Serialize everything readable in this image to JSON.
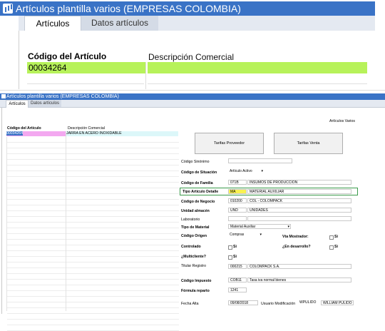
{
  "zoom": {
    "window_title": "Artículos plantilla varios (EMPRESAS COLOMBIA)",
    "tabs": [
      {
        "label": "Artículos",
        "active": true
      },
      {
        "label": "Datos artículos",
        "active": false
      }
    ],
    "code_label": "Código del Artículo",
    "desc_label": "Descripción Comercial",
    "code_value": "00034264",
    "desc_value": "",
    "highlight_color": "#b7f25a"
  },
  "main": {
    "window_title": "Artículos plantilla varios (EMPRESAS COLOMBIA)",
    "tabs": [
      {
        "label": "Artículos",
        "active": true
      },
      {
        "label": "Datos artículos",
        "active": false
      }
    ],
    "section_title": "Artículos Varios",
    "grid": {
      "col_code": "Código del Artículo",
      "col_desc": "Descripción Comercial",
      "first_code": "00034264",
      "first_desc": "JARRA EN ACERO INOXIDABLE"
    },
    "buttons": {
      "tarifas_proveedor": "Tarifas Proveedor",
      "tarifas_venta": "Tarifas Venta"
    },
    "form": {
      "codigo_sinonimo": {
        "label": "Código Sinónimo",
        "value": ""
      },
      "codigo_situacion": {
        "label": "Código de Situación",
        "value": "Artículo Activo"
      },
      "codigo_familia": {
        "label": "Código de Familia",
        "code": "071B",
        "desc": "INSUMOS DE PRODUCCION"
      },
      "tipo_articulo_detalle": {
        "label": "Tipo Artículo Detalle",
        "code": "MA",
        "desc": "MATERIAL AUXILIAR"
      },
      "codigo_negocio": {
        "label": "Código de Negocio",
        "code": "010200",
        "desc": "COL - COLOMPACK"
      },
      "unidad_almacen": {
        "label": "Unidad almacén",
        "code": "UND",
        "desc": "UNIDADES"
      },
      "laboratorio": {
        "label": "Laboratorio",
        "code": "",
        "desc": ""
      },
      "tipo_material": {
        "label": "Tipo de Material",
        "value": "Material Auxiliar"
      },
      "codigo_origen": {
        "label": "Código Origen",
        "value": "Compras"
      },
      "vta_mostrador": {
        "label": "Vta Mostrador:",
        "value": "Si"
      },
      "controlado": {
        "label": "Controlado",
        "value": "Si"
      },
      "en_desarrollo": {
        "label": "¿En desarrollo?",
        "value": "Si"
      },
      "multicliente": {
        "label": "¿Multicliente?",
        "value": "Si"
      },
      "titular_registro": {
        "label": "Titular Registro",
        "code": "000215",
        "desc": "COLOMPACK S.A."
      },
      "codigo_impuesto": {
        "label": "Código Impuesto",
        "code": "COB11",
        "desc": "Tasa iva normal bienes"
      },
      "formula_reparto": {
        "label": "Fórmula reparto",
        "value": "1241"
      },
      "fecha_alta": {
        "label": "Fecha Alta",
        "value": "09/08/2018"
      },
      "usuario_modificacion": {
        "label": "Usuario Modificación",
        "user": "WPULIDO",
        "name": "WILLIAM PULIDO"
      }
    },
    "colors": {
      "title_bar": "#3a73c6",
      "code_cell_pink": "#f3a8f0",
      "desc_cell_cyan": "#dcf7f9",
      "tipo_code_yellow": "#f9f250",
      "highlight_border": "#3b9b4b"
    }
  }
}
